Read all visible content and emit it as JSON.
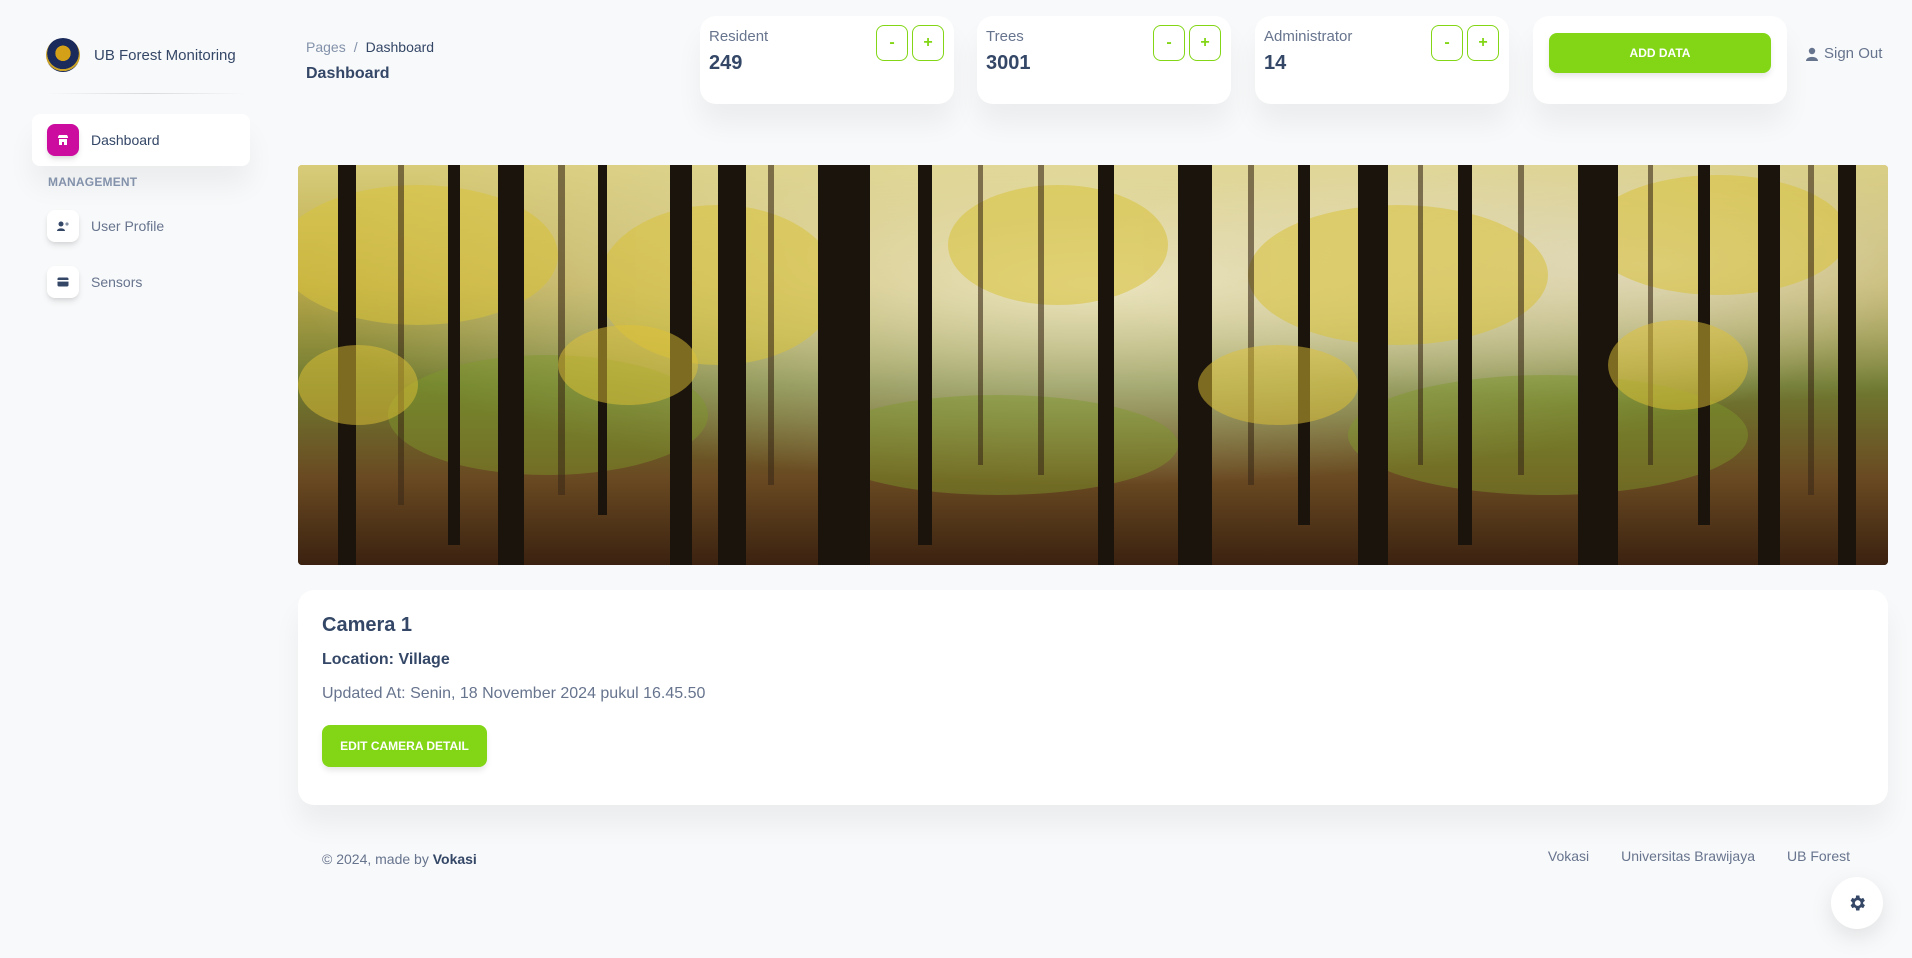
{
  "brand": {
    "name": "UB Forest Monitoring",
    "logo": "university-seal"
  },
  "sidebar": {
    "items": [
      {
        "label": "Dashboard",
        "icon": "shop-icon",
        "active": true
      },
      {
        "label": "User Profile",
        "icon": "user-icon",
        "active": false
      },
      {
        "label": "Sensors",
        "icon": "credit-card-icon",
        "active": false
      }
    ],
    "section_heading": "MANAGEMENT"
  },
  "header": {
    "breadcrumb": {
      "root": "Pages",
      "separator": "/",
      "current": "Dashboard"
    },
    "title": "Dashboard",
    "signout_label": "Sign Out"
  },
  "stats": [
    {
      "label": "Resident",
      "value": "249",
      "minus": "-",
      "plus": "+"
    },
    {
      "label": "Trees",
      "value": "3001",
      "minus": "-",
      "plus": "+"
    },
    {
      "label": "Administrator",
      "value": "14",
      "minus": "-",
      "plus": "+"
    }
  ],
  "add_button_label": "ADD DATA",
  "camera": {
    "title": "Camera 1",
    "location": "Location: Village",
    "updated": "Updated At: Senin, 18 November 2024 pukul 16.45.50",
    "edit_button_label": "EDIT CAMERA DETAIL"
  },
  "footer": {
    "copy_prefix": "© 2024, made by",
    "copy_brand": "Vokasi",
    "links": [
      "Vokasi",
      "Universitas Brawijaya",
      "UB Forest"
    ]
  },
  "colors": {
    "accent": "#82d616",
    "active_nav": "#cb0c9f",
    "text": "#344767",
    "muted": "#67748e"
  }
}
